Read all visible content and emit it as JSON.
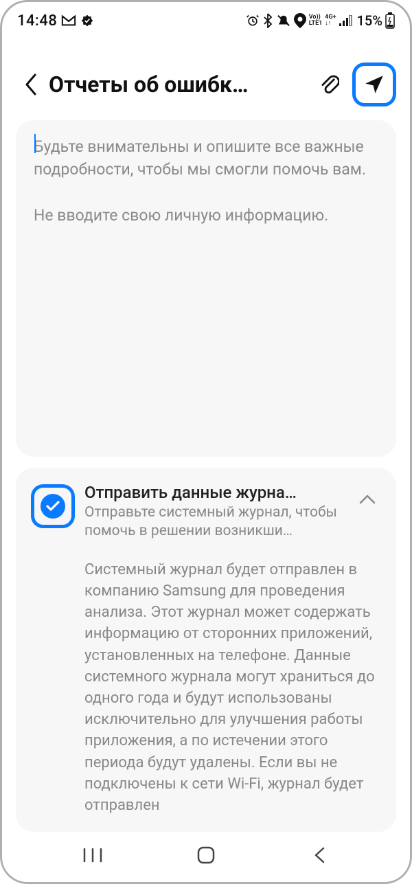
{
  "status": {
    "time": "14:48",
    "battery_percent": "15%",
    "indicators": {
      "volte": "Vo))\nLTE1",
      "net": "4G+",
      "gmail": true,
      "check": true,
      "alarm": true,
      "bluetooth": true,
      "mute": true,
      "location": true,
      "signal": true,
      "battery_charging": true
    }
  },
  "header": {
    "title": "Отчеты об ошибк…"
  },
  "textarea": {
    "placeholder": "Будьте внимательны и опишите все важные подробности, чтобы мы смогли помочь вам.\n\nНе вводите свою личную информацию."
  },
  "log_section": {
    "checked": true,
    "title": "Отправить данные журна…",
    "subtitle": "Отправьте системный журнал, чтобы помочь в решении возникши…",
    "body": "Системный журнал будет отправлен в компанию Samsung для проведения анализа. Этот журнал может содержать информацию от сторонних приложений, установленных на телефоне. Данные системного журнала могут храниться до одного года и будут использованы исключительно для улучшения работы приложения, а по истечении этого периода будут удалены. Если вы не подключены к сети Wi-Fi, журнал будет отправлен"
  },
  "colors": {
    "accent": "#0a7aff"
  }
}
